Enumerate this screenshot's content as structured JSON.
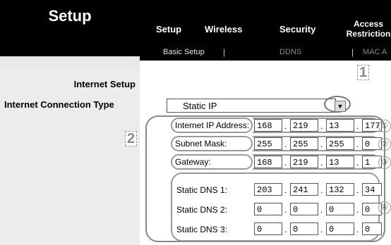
{
  "app": {
    "title": "Setup"
  },
  "tabs": [
    {
      "label": "Setup"
    },
    {
      "label": "Wireless"
    },
    {
      "label": "Security"
    },
    {
      "label": "Access",
      "label2": "Restriction"
    }
  ],
  "subtabs": [
    {
      "label": "Basic Setup"
    },
    {
      "label": "DDNS"
    },
    {
      "label": "MAC A"
    }
  ],
  "sidebar": {
    "section_title": "Internet Setup",
    "connection_type_label": "Internet Connection Type"
  },
  "connection_select": {
    "value": "Static IP"
  },
  "markers": {
    "m1": "1",
    "m2": "2"
  },
  "fields": {
    "ip": {
      "label": "Internet IP Address:",
      "octets": [
        "168",
        "219",
        "13",
        "177"
      ],
      "callout": "①"
    },
    "mask": {
      "label": "Subnet Mask:",
      "octets": [
        "255",
        "255",
        "255",
        "0"
      ],
      "callout": "②"
    },
    "gateway": {
      "label": "Gateway:",
      "octets": [
        "168",
        "219",
        "13",
        "1"
      ],
      "callout": "③"
    },
    "dns1": {
      "label": "Static DNS 1:",
      "octets": [
        "203",
        "241",
        "132",
        "34"
      ]
    },
    "dns2": {
      "label": "Static DNS 2:",
      "octets": [
        "0",
        "0",
        "0",
        "0"
      ]
    },
    "dns3": {
      "label": "Static DNS 3:",
      "octets": [
        "0",
        "0",
        "0",
        "0"
      ]
    },
    "dns_callout": "④",
    "separator": "."
  }
}
